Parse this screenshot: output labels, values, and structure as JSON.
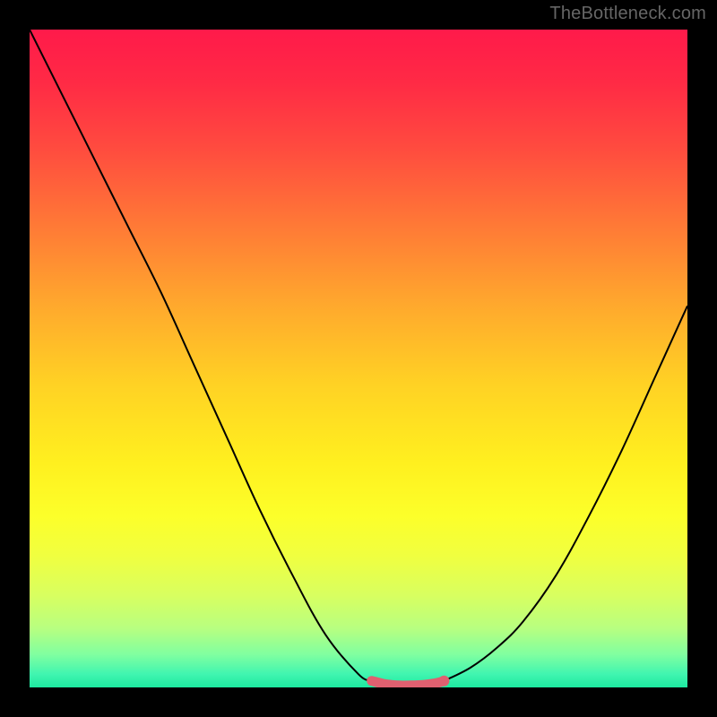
{
  "watermark": "TheBottleneck.com",
  "chart_data": {
    "type": "line",
    "title": "",
    "xlabel": "",
    "ylabel": "",
    "xlim": [
      0,
      100
    ],
    "ylim": [
      0,
      100
    ],
    "grid": false,
    "legend_position": "none",
    "series": [
      {
        "name": "left-curve",
        "color": "#000000",
        "x": [
          0,
          5,
          10,
          15,
          20,
          25,
          30,
          35,
          40,
          45,
          50,
          52
        ],
        "values": [
          100,
          90,
          80,
          70,
          60,
          49,
          38,
          27,
          17,
          8,
          2,
          1
        ]
      },
      {
        "name": "right-curve",
        "color": "#000000",
        "x": [
          63,
          67,
          71,
          75,
          80,
          85,
          90,
          95,
          100
        ],
        "values": [
          1,
          3,
          6,
          10,
          17,
          26,
          36,
          47,
          58
        ]
      },
      {
        "name": "optimum-band",
        "color": "#e06070",
        "x": [
          52,
          54,
          56,
          58,
          60,
          62,
          63
        ],
        "values": [
          1,
          0.5,
          0.3,
          0.3,
          0.4,
          0.7,
          1
        ]
      }
    ],
    "annotations": []
  },
  "colors": {
    "page_bg": "#000000",
    "curve": "#000000",
    "optimum": "#e06070",
    "watermark": "#666666"
  }
}
